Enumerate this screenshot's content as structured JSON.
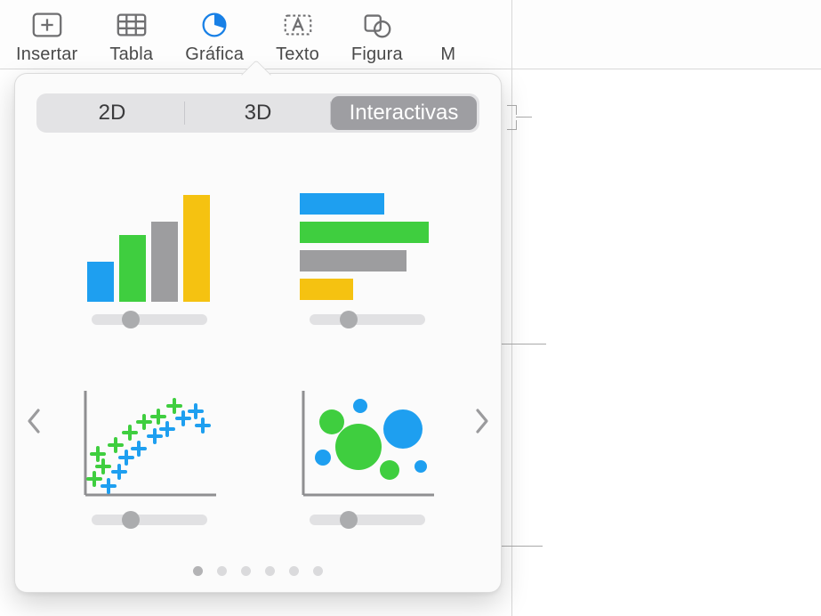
{
  "toolbar": {
    "items": [
      {
        "label": "Insertar",
        "icon": "insert"
      },
      {
        "label": "Tabla",
        "icon": "table"
      },
      {
        "label": "Gráfica",
        "icon": "pie-chart",
        "active": true
      },
      {
        "label": "Texto",
        "icon": "text-box"
      },
      {
        "label": "Figura",
        "icon": "shapes"
      }
    ],
    "overflow_label": "M"
  },
  "chart_popover": {
    "tabs": [
      "2D",
      "3D",
      "Interactivas"
    ],
    "selected_tab_index": 2,
    "page_count": 6,
    "current_page_index": 0,
    "options": [
      {
        "name": "interactive-column-chart",
        "icon": "column-bars"
      },
      {
        "name": "interactive-bar-chart",
        "icon": "horizontal-bars"
      },
      {
        "name": "interactive-scatter-chart",
        "icon": "scatter-plus"
      },
      {
        "name": "interactive-bubble-chart",
        "icon": "bubbles"
      }
    ],
    "colors": {
      "blue": "#1e9ff0",
      "green": "#3fce3f",
      "gray": "#9d9d9f",
      "yellow": "#f5c211",
      "axis": "#8f8f91"
    }
  }
}
